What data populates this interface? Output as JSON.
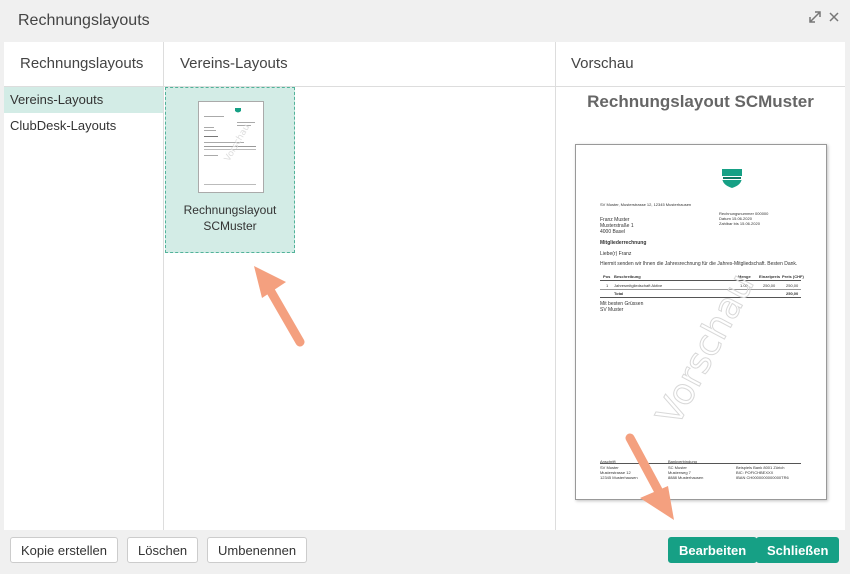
{
  "window": {
    "title": "Rechnungslayouts"
  },
  "columns": {
    "layouts": "Rechnungslayouts",
    "vereins": "Vereins-Layouts",
    "preview": "Vorschau"
  },
  "sidebar": {
    "items": [
      {
        "label": "Vereins-Layouts"
      },
      {
        "label": "ClubDesk-Layouts"
      }
    ]
  },
  "layout_tile": {
    "line1": "Rechnungslayout",
    "line2": "SCMuster"
  },
  "preview": {
    "title": "Rechnungslayout SCMuster",
    "watermark": "Vorschau",
    "document": {
      "sender_line": "SV Muster, Musterstrasse 12, 12345 Musterhausen",
      "invoice_meta": [
        "Rechnungsnummer 000000",
        "Datum        15.06.2020",
        "Zahlbar bis    15.06.2020"
      ],
      "recipient": [
        "Franz Muster",
        "Musterstraße 1",
        "4000 Basel"
      ],
      "subject": "Mitgliederrechnung",
      "salutation": "Liebe(r) Franz",
      "intro": "Hiermit senden wir Ihnen die Jahresrechnung für die Jahres-Mitgliedschaft. Besten Dank.",
      "table_headers": [
        "Pos",
        "Beschreibung",
        "Menge",
        "Einzelpreis",
        "Preis (CHF)"
      ],
      "table_row": [
        "1",
        "Jahresmitgliedschaft Aktive",
        "1.00",
        "250,00",
        "250,00"
      ],
      "total_label": "Total",
      "total_value": "250,00",
      "closing": [
        "Mit besten Grüssen",
        "SV Muster"
      ],
      "footer": {
        "col1_head": "Anschrift",
        "col1": [
          "SV Muster",
          "Musterstrasse 12",
          "12345 Musterhausen"
        ],
        "col2_head": "Bankverbindung",
        "col2": [
          "SC Muster",
          "Musterweg 7",
          "8888 Musterhausen"
        ],
        "col3": [
          "Beispiels Bank 8001 Zürich",
          "BIC: POFICHBEXXX",
          "IBAN CH0000000000000TR6"
        ]
      }
    }
  },
  "buttons": {
    "copy": "Kopie erstellen",
    "delete": "Löschen",
    "rename": "Umbenennen",
    "edit": "Bearbeiten",
    "close": "Schließen"
  },
  "colors": {
    "accent": "#16a085",
    "selection": "#d3ece6",
    "arrow": "#f4a07f"
  }
}
